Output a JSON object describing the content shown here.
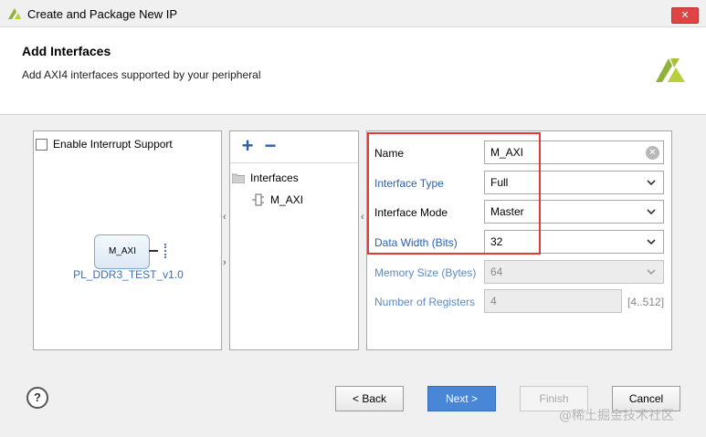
{
  "window": {
    "title": "Create and Package New IP",
    "close_label": "✕"
  },
  "header": {
    "title": "Add Interfaces",
    "subtitle": "Add AXI4 interfaces supported by your peripheral"
  },
  "left_panel": {
    "interrupt_label": "Enable Interrupt Support",
    "interrupt_checked": false,
    "block_port": "M_AXI",
    "ip_name": "PL_DDR3_TEST_v1.0"
  },
  "middle_panel": {
    "add_label": "+",
    "remove_label": "−",
    "tree_root": "Interfaces",
    "tree_items": [
      "M_AXI"
    ]
  },
  "properties": {
    "name": {
      "label": "Name",
      "value": "M_AXI"
    },
    "interface_type": {
      "label": "Interface Type",
      "value": "Full"
    },
    "interface_mode": {
      "label": "Interface Mode",
      "value": "Master"
    },
    "data_width": {
      "label": "Data Width (Bits)",
      "value": "32"
    },
    "memory_size": {
      "label": "Memory Size (Bytes)",
      "value": "64"
    },
    "num_registers": {
      "label": "Number of Registers",
      "value": "4",
      "range": "[4..512]"
    }
  },
  "footer": {
    "help_label": "?",
    "back_label": "< Back",
    "next_label": "Next >",
    "finish_label": "Finish",
    "cancel_label": "Cancel"
  },
  "watermark": "@稀土掘金技术社区",
  "colors": {
    "accent": "#4a86d6",
    "highlight": "#e53935",
    "link": "#2a62b8"
  }
}
